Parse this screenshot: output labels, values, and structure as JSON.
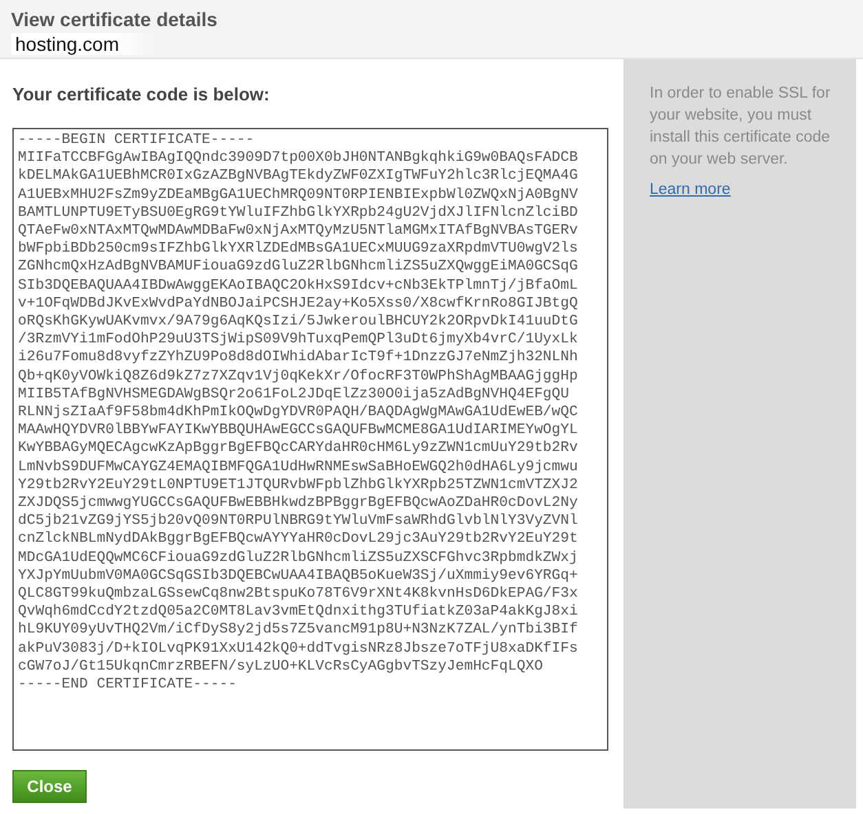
{
  "header": {
    "title": "View certificate details",
    "domain": "hosting.com"
  },
  "main": {
    "heading": "Your certificate code is below:",
    "certificate_code": [
      "-----BEGIN CERTIFICATE-----",
      "MIIFaTCCBFGgAwIBAgIQQndc3909D7tp00X0bJH0NTANBgkqhkiG9w0BAQsFADCB",
      "kDELMAkGA1UEBhMCR0IxGzAZBgNVBAgTEkdyZWF0ZXIgTWFuY2hlc3RlcjEQMA4G",
      "A1UEBxMHU2FsZm9yZDEaMBgGA1UEChMRQ09NT0RPIENBIExpbWl0ZWQxNjA0BgNV",
      "BAMTLUNPTU9ETyBSU0EgRG9tYWluIFZhbGlkYXRpb24gU2VjdXJlIFNlcnZlciBD",
      "QTAeFw0xNTAxMTQwMDAwMDBaFw0xNjAxMTQyMzU5NTlaMGMxITAfBgNVBAsTGERv",
      "bWFpbiBDb250cm9sIFZhbGlkYXRlZDEdMBsGA1UECxMUUG9zaXRpdmVTU0wgV2ls",
      "ZGNhcmQxHzAdBgNVBAMUFiouaG9zdGluZ2RlbGNhcmliZS5uZXQwggEiMA0GCSqG",
      "SIb3DQEBAQUAA4IBDwAwggEKAoIBAQC2OkHxS9Idcv+cNb3EkTPlmnTj/jBfaOmL",
      "v+1OFqWDBdJKvExWvdPaYdNBOJaiPCSHJE2ay+Ko5Xss0/X8cwfKrnRo8GIJBtgQ",
      "oRQsKhGKywUAKvmvx/9A79g6AqKQsIzi/5JwkeroulBHCUY2k2ORpvDkI41uuDtG",
      "/3RzmVYi1mFodOhP29uU3TSjWipS09V9hTuxqPemQPl3uDt6jmyXb4vrC/1UyxLk",
      "i26u7Fomu8d8vyfzZYhZU9Po8d8dOIWhidAbarIcT9f+1DnzzGJ7eNmZjh32NLNh",
      "Qb+qK0yVOWkiQ8Z6d9kZ7z7XZqv1Vj0qKekXr/OfocRF3T0WPhShAgMBAAGjggHp",
      "MIIB5TAfBgNVHSMEGDAWgBSQr2o61FoL2JDqElZz30O0ija5zAdBgNVHQ4EFgQU",
      "RLNNjsZIaAf9F58bm4dKhPmIkOQwDgYDVR0PAQH/BAQDAgWgMAwGA1UdEwEB/wQC",
      "MAAwHQYDVR0lBBYwFAYIKwYBBQUHAwEGCCsGAQUFBwMCME8GA1UdIARIMEYwOgYL",
      "KwYBBAGyMQECAgcwKzApBggrBgEFBQcCARYdaHR0cHM6Ly9zZWN1cmUuY29tb2Rv",
      "LmNvbS9DUFMwCAYGZ4EMAQIBMFQGA1UdHwRNMEswSaBHoEWGQ2h0dHA6Ly9jcmwu",
      "Y29tb2RvY2EuY29tL0NPTU9ET1JTQURvbWFpblZhbGlkYXRpb25TZWN1cmVTZXJ2",
      "ZXJDQS5jcmwwgYUGCCsGAQUFBwEBBHkwdzBPBggrBgEFBQcwAoZDaHR0cDovL2Ny",
      "dC5jb21vZG9jYS5jb20vQ09NT0RPUlNBRG9tYWluVmFsaWRhdGlvblNlY3VyZVNl",
      "cnZlckNBLmNydDAkBggrBgEFBQcwAYYYaHR0cDovL29jc3AuY29tb2RvY2EuY29t",
      "MDcGA1UdEQQwMC6CFiouaG9zdGluZ2RlbGNhcmliZS5uZXSCFGhvc3RpbmdkZWxj",
      "YXJpYmUubmV0MA0GCSqGSIb3DQEBCwUAA4IBAQB5oKueW3Sj/uXmmiy9ev6YRGq+",
      "QLC8GT99kuQmbzaLGSsewCq8nw2BtspuKo78T6V9rXNt4K8kvnHsD6DkEPAG/F3x",
      "QvWqh6mdCcdY2tzdQ05a2C0MT8Lav3vmEtQdnxithg3TUfiatkZ03aP4akKgJ8xi",
      "hL9KUY09yUvTHQ2Vm/iCfDyS8y2jd5s7Z5vancM91p8U+N3NzK7ZAL/ynTbi3BIf",
      "akPuV3083j/D+kIOLvqPK91XxU142kQ0+ddTvgisNRz8Jbsze7oTFjU8xaDKfIFs",
      "cGW7oJ/Gt15UkqnCmrzRBEFN/syLzUO+KLVcRsCyAGgbvTSzyJemHcFqLQXO",
      "-----END CERTIFICATE-----"
    ],
    "close_button": "Close"
  },
  "sidebar": {
    "text": "In order to enable SSL for your website, you must install this certificate code on your web server.",
    "link": "Learn more"
  }
}
